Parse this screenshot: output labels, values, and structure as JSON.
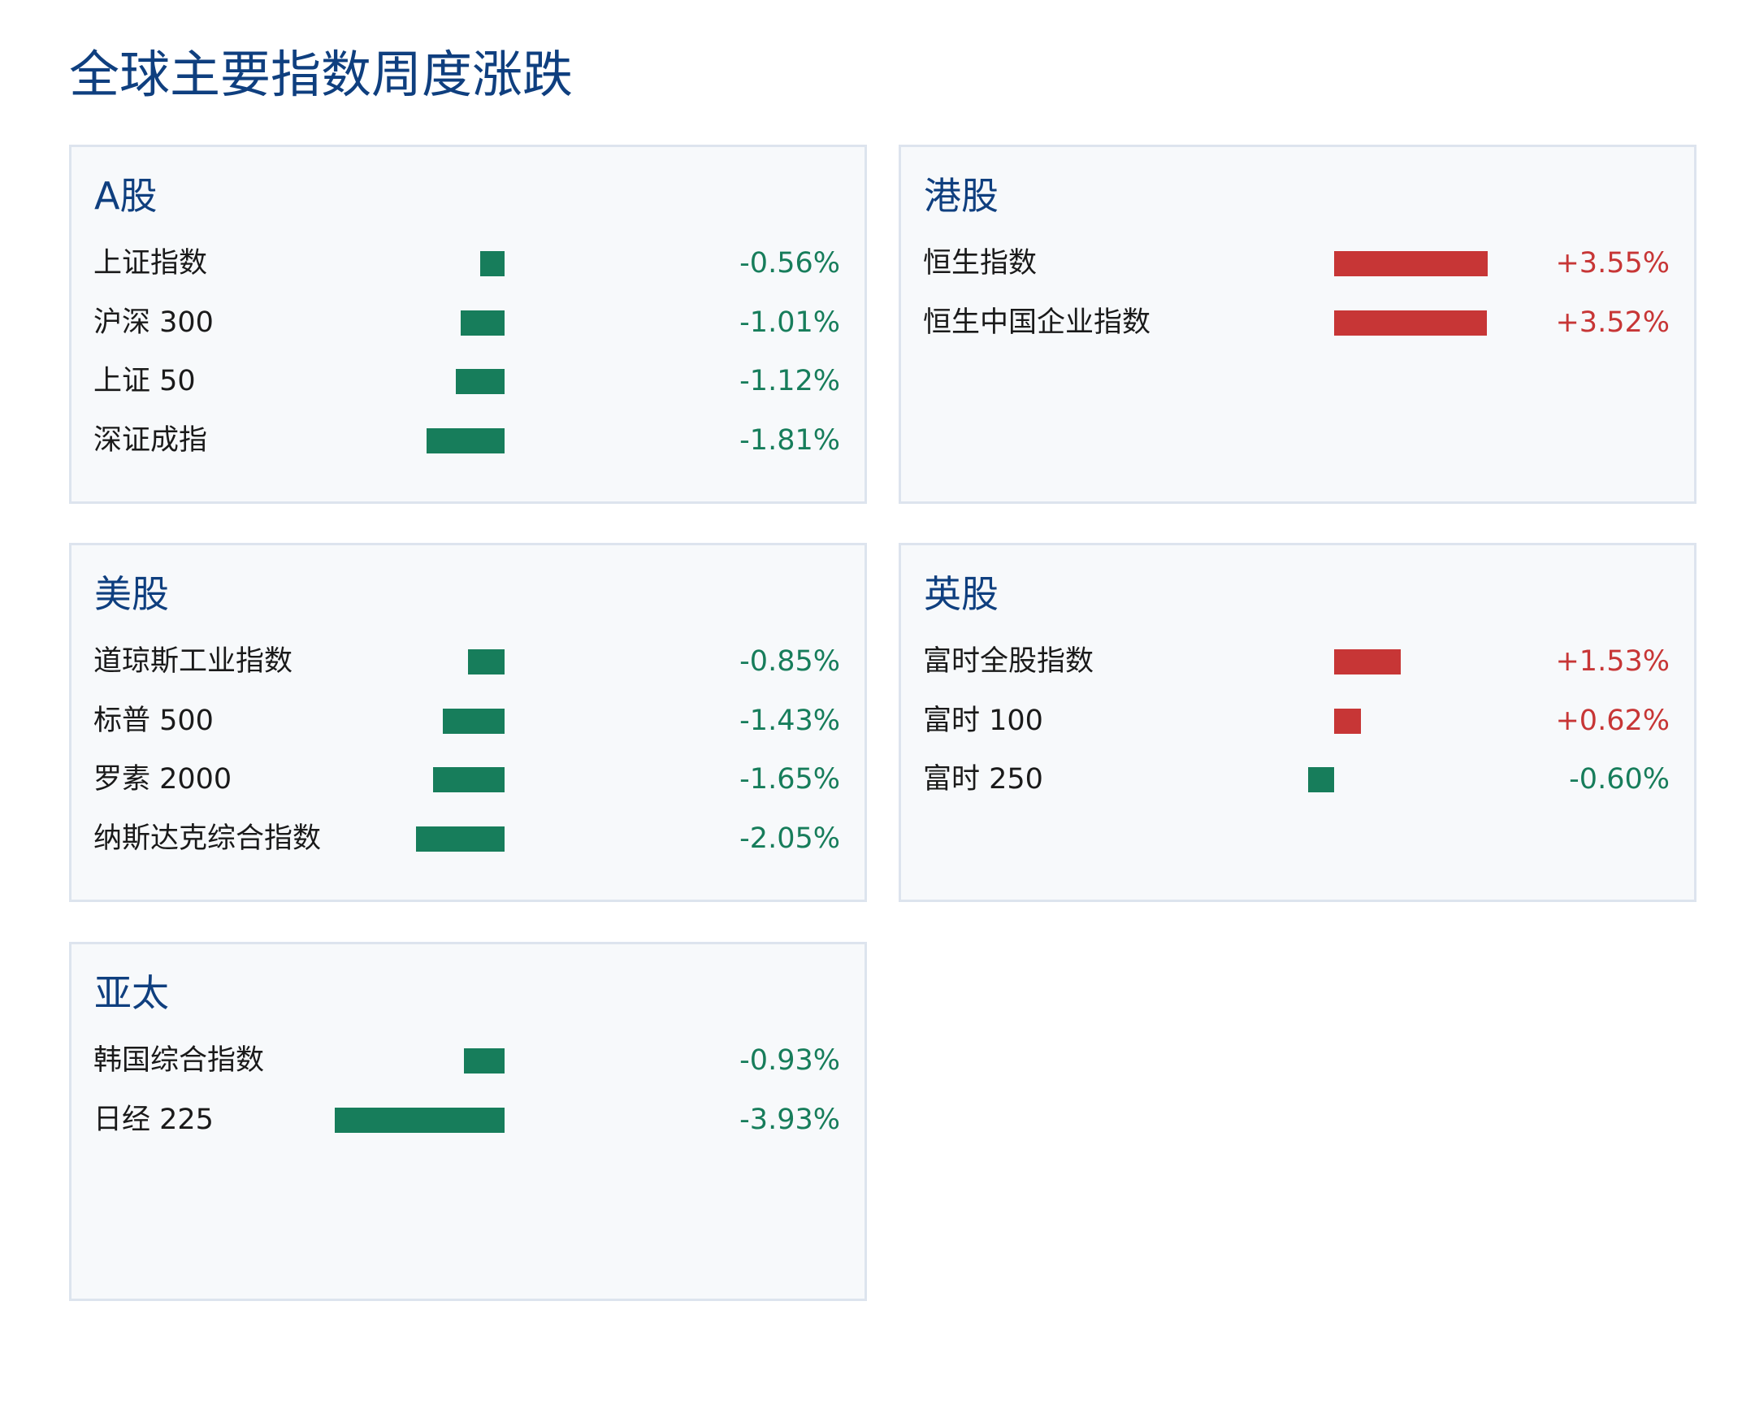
{
  "title": "全球主要指数周度涨跌",
  "colors": {
    "up": "#c73636",
    "down": "#177d5b",
    "title": "#0f3f7f",
    "panel_bg": "#f7f9fb",
    "panel_border": "#dde4ee"
  },
  "chart_data": {
    "type": "bar",
    "title": "全球主要指数周度涨跌",
    "unit": "%",
    "groups": [
      {
        "name": "A股",
        "items": [
          {
            "name": "上证指数",
            "value": -0.56,
            "label": "-0.56%"
          },
          {
            "name": "沪深 300",
            "value": -1.01,
            "label": "-1.01%"
          },
          {
            "name": "上证 50",
            "value": -1.12,
            "label": "-1.12%"
          },
          {
            "name": "深证成指",
            "value": -1.81,
            "label": "-1.81%"
          }
        ]
      },
      {
        "name": "港股",
        "items": [
          {
            "name": "恒生指数",
            "value": 3.55,
            "label": "+3.55%"
          },
          {
            "name": "恒生中国企业指数",
            "value": 3.52,
            "label": "+3.52%"
          }
        ]
      },
      {
        "name": "美股",
        "items": [
          {
            "name": "道琼斯工业指数",
            "value": -0.85,
            "label": "-0.85%"
          },
          {
            "name": "标普 500",
            "value": -1.43,
            "label": "-1.43%"
          },
          {
            "name": "罗素 2000",
            "value": -1.65,
            "label": "-1.65%"
          },
          {
            "name": "纳斯达克综合指数",
            "value": -2.05,
            "label": "-2.05%"
          }
        ]
      },
      {
        "name": "英股",
        "items": [
          {
            "name": "富时全股指数",
            "value": 1.53,
            "label": "+1.53%"
          },
          {
            "name": "富时 100",
            "value": 0.62,
            "label": "+0.62%"
          },
          {
            "name": "富时 250",
            "value": -0.6,
            "label": "-0.60%"
          }
        ]
      },
      {
        "name": "亚太",
        "items": [
          {
            "name": "韩国综合指数",
            "value": -0.93,
            "label": "-0.93%"
          },
          {
            "name": "日经 225",
            "value": -3.93,
            "label": "-3.93%"
          }
        ]
      }
    ]
  }
}
